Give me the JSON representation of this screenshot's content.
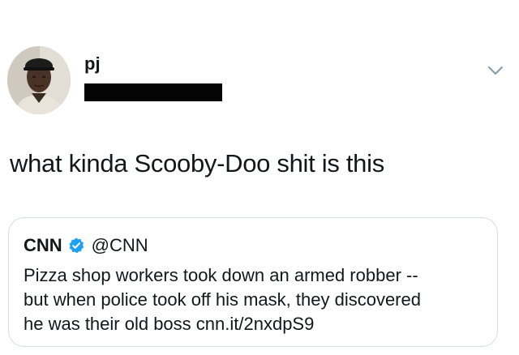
{
  "tweet": {
    "author": {
      "display_name": "pj",
      "avatar_icon": "profile-photo"
    },
    "menu_icon": "chevron-down-icon",
    "text": "what kinda Scooby-Doo shit is this"
  },
  "quoted_tweet": {
    "author": {
      "name": "CNN",
      "handle": "@CNN",
      "verified_icon": "verified-badge-icon"
    },
    "lines": [
      "Pizza shop workers took down an armed robber --",
      "but when police took off his mask, they discovered",
      "he was their old boss"
    ],
    "link": "cnn.it/2nxdpS9"
  },
  "colors": {
    "text": "#14171a",
    "verified": "#1da1f2",
    "card_border": "#d8dde2",
    "redaction": "#050505"
  }
}
